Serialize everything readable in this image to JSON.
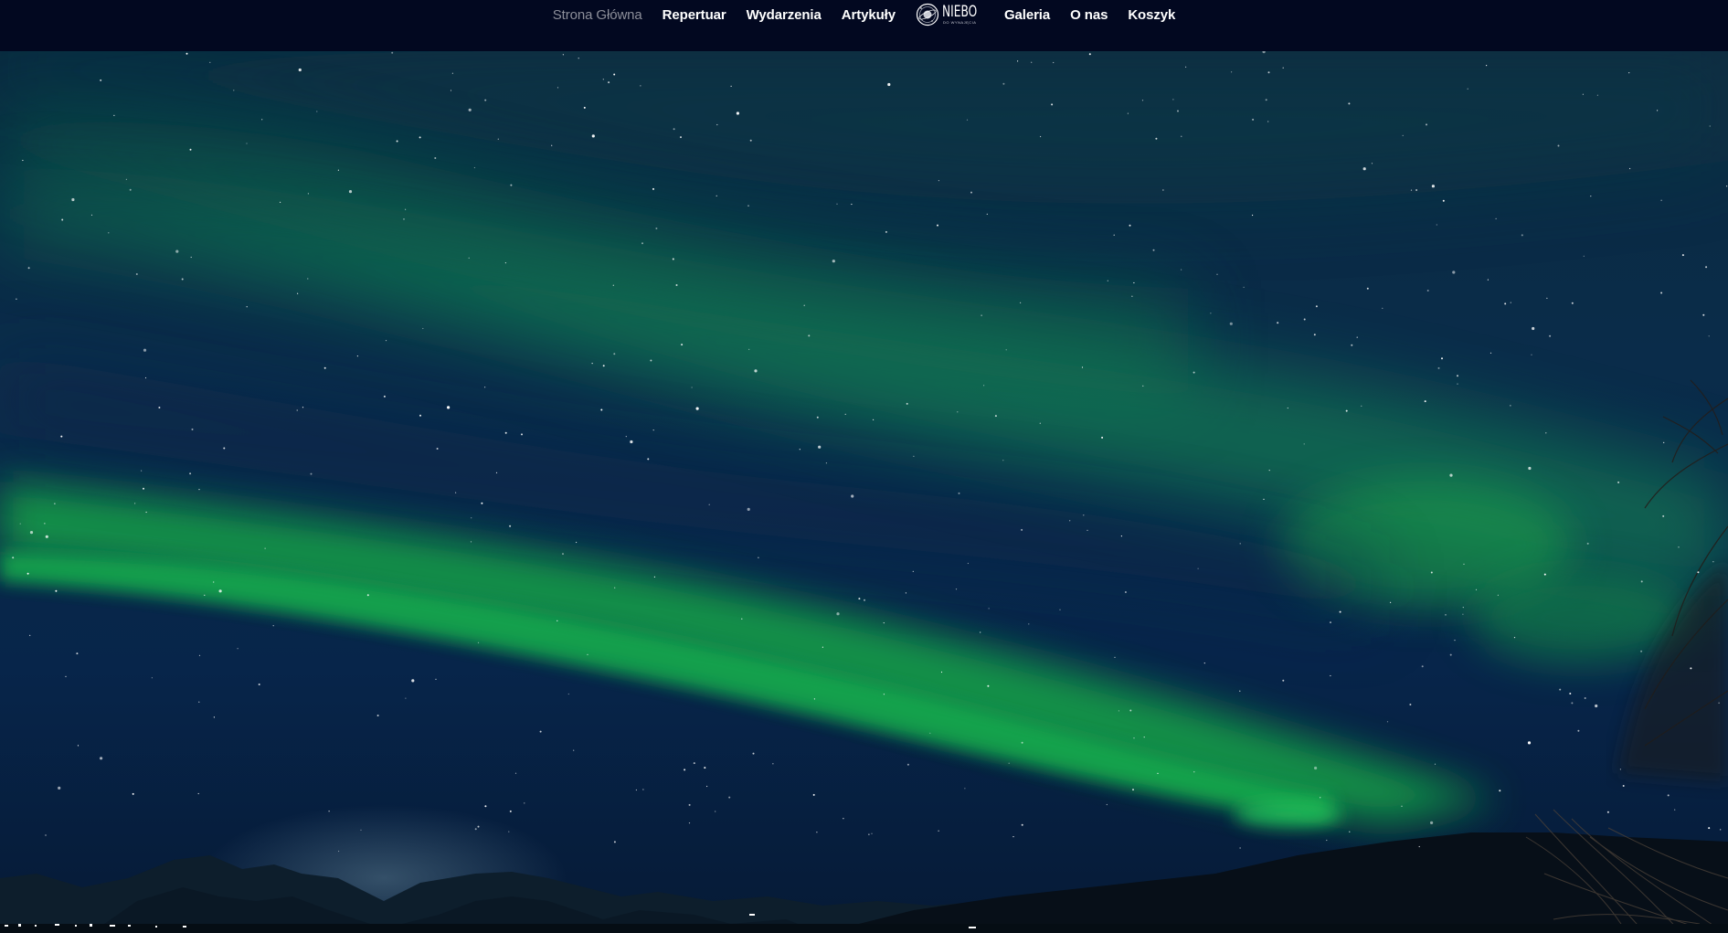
{
  "nav": {
    "items_left": [
      "Strona Główna",
      "Repertuar",
      "Wydarzenia",
      "Artykuły"
    ],
    "items_right": [
      "Galeria",
      "O nas",
      "Koszyk"
    ],
    "active": "Strona Główna",
    "logo": {
      "word": "NIEBO",
      "tagline": "DO WYNAJĘCIA",
      "icon": "planet-logo-icon"
    }
  },
  "colors": {
    "nav_background": "#020820",
    "nav_text": "#ffffff",
    "nav_active_text": "#8d8f9a",
    "sky_top": "#0a2244",
    "aurora_green": "#12a34a",
    "ground": "#06101a"
  },
  "hero": {
    "image": "aurora-borealis-night-sky"
  }
}
